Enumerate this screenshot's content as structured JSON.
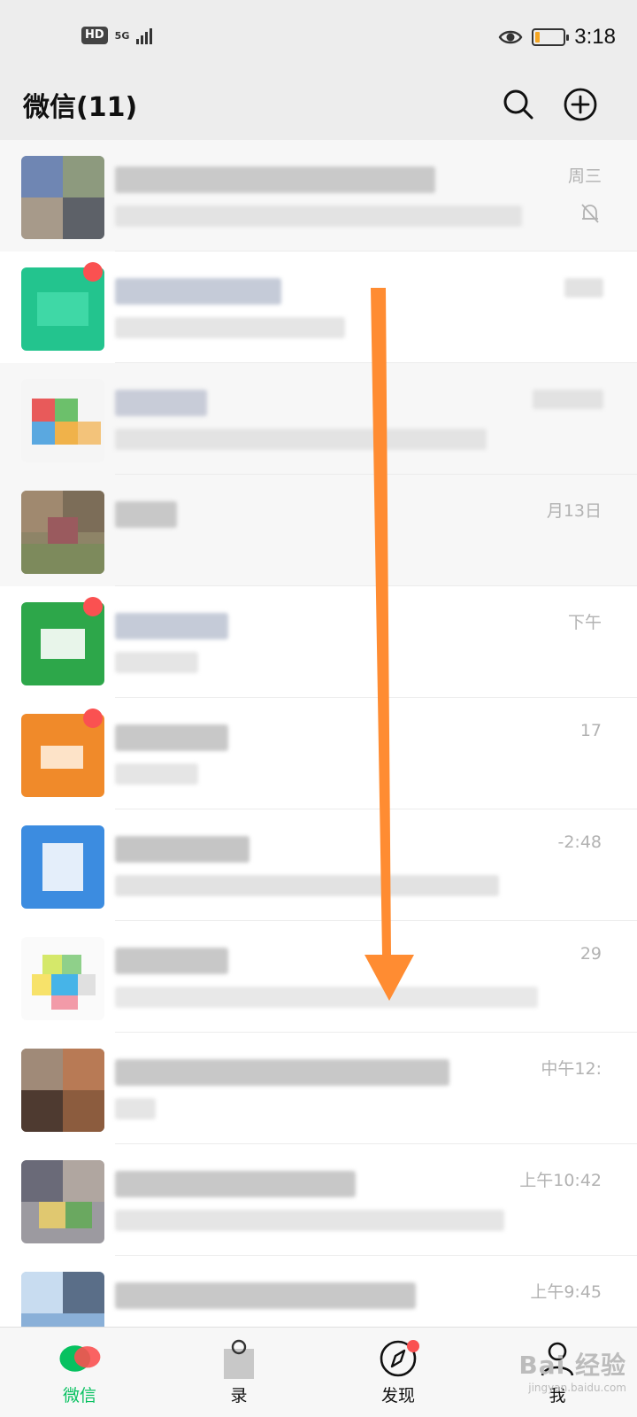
{
  "status_bar": {
    "hd": "HD",
    "network": "5G",
    "time": "3:18",
    "battery_level": 0.15,
    "battery_color": "#f5a623"
  },
  "header": {
    "title": "微信(11)",
    "search_icon": "search-icon",
    "add_icon": "plus-circle-icon"
  },
  "chats": [
    {
      "time": "周三",
      "muted": true,
      "unread": false
    },
    {
      "time": "",
      "muted": false,
      "unread": true
    },
    {
      "time": "",
      "muted": false,
      "unread": false
    },
    {
      "time": "月13日",
      "muted": false,
      "unread": false
    },
    {
      "time": "下午",
      "muted": false,
      "unread": true
    },
    {
      "time": "17",
      "muted": false,
      "unread": true
    },
    {
      "time": "-2:48",
      "muted": false,
      "unread": false
    },
    {
      "time": "29",
      "muted": false,
      "unread": false
    },
    {
      "time": "中午12:",
      "muted": false,
      "unread": false
    },
    {
      "time": "上午10:42",
      "muted": false,
      "unread": false
    },
    {
      "time": "上午9:45",
      "muted": false,
      "unread": false
    }
  ],
  "tabs": [
    {
      "label": "微信",
      "icon": "chat-bubbles-icon",
      "active": true
    },
    {
      "label": "录",
      "icon": "contacts-icon",
      "active": false
    },
    {
      "label": "发现",
      "icon": "compass-icon",
      "active": false
    },
    {
      "label": "我",
      "icon": "person-icon",
      "active": false
    }
  ],
  "colors": {
    "accent": "#07c160",
    "badge": "#fa5151",
    "arrow": "#ff8c32"
  },
  "watermark": {
    "main": "Bai 经验",
    "sub": "jingyan.baidu.com"
  }
}
